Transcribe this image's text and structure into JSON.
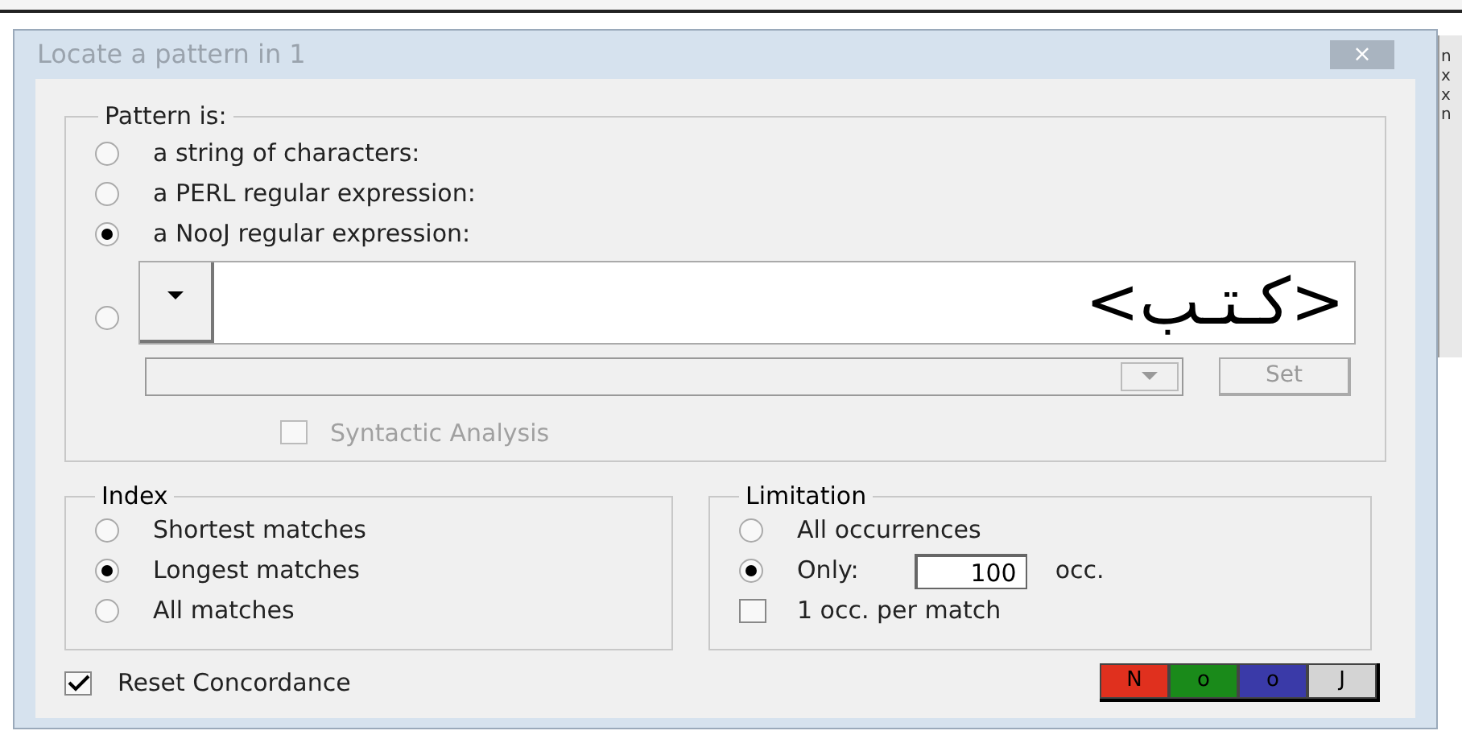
{
  "window": {
    "title": "Locate a pattern in 1",
    "close": "×"
  },
  "background_window_letters": [
    "n",
    "x",
    "x",
    "n"
  ],
  "pattern": {
    "legend": "Pattern is:",
    "options": [
      {
        "label": "a string of characters:",
        "selected": false
      },
      {
        "label": "a PERL regular expression:",
        "selected": false
      },
      {
        "label": "a NooJ regular expression:",
        "selected": true
      }
    ],
    "other_option": {
      "selected": false
    },
    "expression": {
      "value": "<كـتـب>"
    },
    "grammar_combo": {
      "disabled": true
    },
    "set_button": {
      "label": "Set",
      "disabled": true
    },
    "syntactic": {
      "label": "Syntactic Analysis",
      "checked": false,
      "disabled": true
    }
  },
  "index": {
    "legend": "Index",
    "options": [
      {
        "label": "Shortest matches",
        "selected": false
      },
      {
        "label": "Longest matches",
        "selected": true
      },
      {
        "label": "All matches",
        "selected": false
      }
    ]
  },
  "limitation": {
    "legend": "Limitation",
    "options": [
      {
        "label": "All occurrences",
        "selected": false
      },
      {
        "label": "Only:",
        "selected": true
      }
    ],
    "count": "100",
    "unit": "occ.",
    "per_match": {
      "label": "1 occ. per match",
      "checked": false
    }
  },
  "reset": {
    "label": "Reset Concordance",
    "checked": true
  },
  "nooj_buttons": [
    {
      "label": "N",
      "color": "#e0301e"
    },
    {
      "label": "o",
      "color": "#1a8a1a"
    },
    {
      "label": "o",
      "color": "#3a3aa8"
    },
    {
      "label": "J",
      "color": "#d4d4d4"
    }
  ]
}
